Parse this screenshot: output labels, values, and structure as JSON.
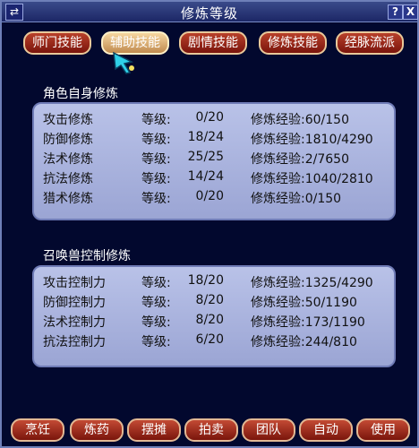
{
  "window": {
    "title": "修炼等级",
    "menu_icon": "⇄",
    "help_label": "?",
    "close_label": "X"
  },
  "tabs": [
    {
      "label": "师门技能"
    },
    {
      "label": "辅助技能"
    },
    {
      "label": "剧情技能"
    },
    {
      "label": "修炼技能"
    },
    {
      "label": "经脉流派"
    }
  ],
  "active_tab": 1,
  "self_section": {
    "title": "角色自身修炼",
    "level_label": "等级:",
    "exp_label": "修炼经验:",
    "rows": [
      {
        "name": "攻击修炼",
        "level": "0/20",
        "exp": "60/150"
      },
      {
        "name": "防御修炼",
        "level": "18/24",
        "exp": "1810/4290"
      },
      {
        "name": "法术修炼",
        "level": "25/25",
        "exp": "2/7650"
      },
      {
        "name": "抗法修炼",
        "level": "14/24",
        "exp": "1040/2810"
      },
      {
        "name": "猎术修炼",
        "level": "0/20",
        "exp": "0/150"
      }
    ]
  },
  "pet_section": {
    "title": "召唤兽控制修炼",
    "level_label": "等级:",
    "exp_label": "修炼经验:",
    "rows": [
      {
        "name": "攻击控制力",
        "level": "18/20",
        "exp": "1325/4290"
      },
      {
        "name": "防御控制力",
        "level": "8/20",
        "exp": "50/1190"
      },
      {
        "name": "法术控制力",
        "level": "8/20",
        "exp": "173/1190"
      },
      {
        "name": "抗法控制力",
        "level": "6/20",
        "exp": "244/810"
      }
    ]
  },
  "bottom_buttons": [
    {
      "label": "烹饪"
    },
    {
      "label": "炼药"
    },
    {
      "label": "摆摊"
    },
    {
      "label": "拍卖"
    },
    {
      "label": "团队"
    },
    {
      "label": "自动"
    },
    {
      "label": "使用"
    }
  ],
  "colors": {
    "background": "#02082e",
    "panel": "#aab3de",
    "button_red": "#a02818",
    "button_active": "#e2b880"
  },
  "icons": {
    "menu": "swap-arrows-icon",
    "cursor": "pointer-cursor-icon"
  }
}
